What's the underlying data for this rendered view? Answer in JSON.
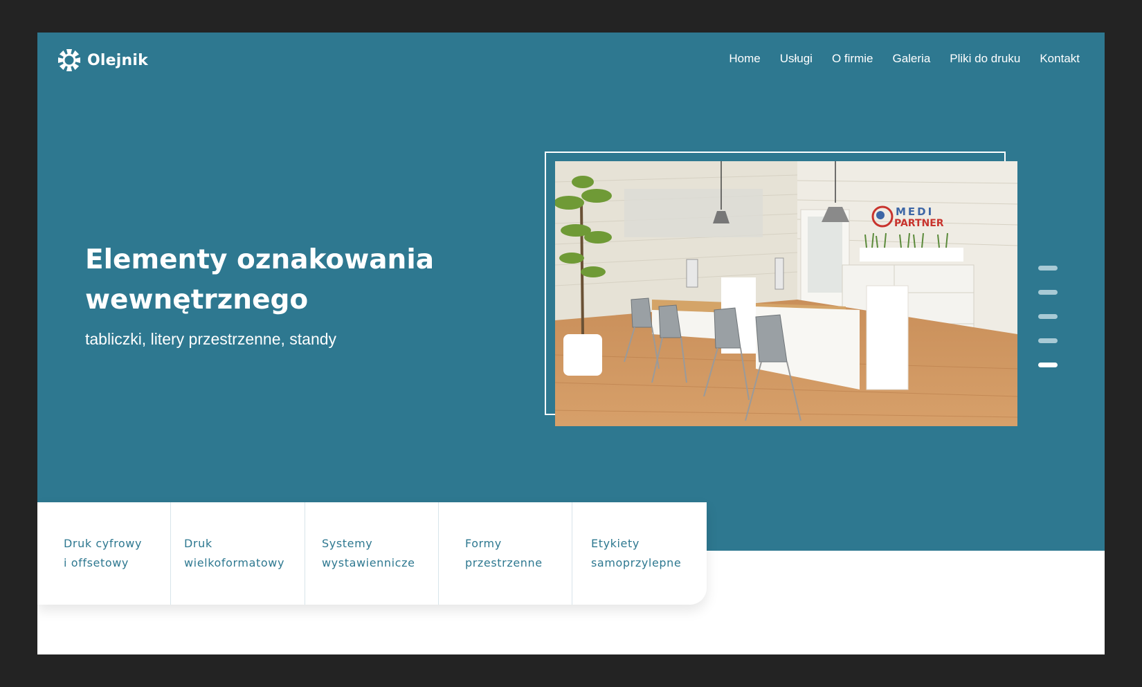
{
  "brand": {
    "name": "Olejnik",
    "logo_icon": "olejnik-logo-icon",
    "accent": "#2e7890"
  },
  "nav": {
    "items": [
      {
        "label": "Home"
      },
      {
        "label": "Usługi"
      },
      {
        "label": "O firmie"
      },
      {
        "label": "Galeria"
      },
      {
        "label": "Pliki do druku"
      },
      {
        "label": "Kontakt"
      }
    ]
  },
  "hero": {
    "title": "Elementy oznakowania wewnętrznego",
    "subtitle": "tabliczki, litery przestrzenne, standy",
    "image_sign_text_line1": "MEDI",
    "image_sign_text_line2": "PARTNER",
    "slider": {
      "total": 5,
      "active_index": 5
    }
  },
  "services": [
    {
      "label": "Druk cyfrowy\ni offsetowy"
    },
    {
      "label": "Druk\nwielkoformatowy"
    },
    {
      "label": "Systemy\nwystawiennicze"
    },
    {
      "label": "Formy\nprzestrzenne"
    },
    {
      "label": "Etykiety\nsamoprzylepne"
    }
  ]
}
